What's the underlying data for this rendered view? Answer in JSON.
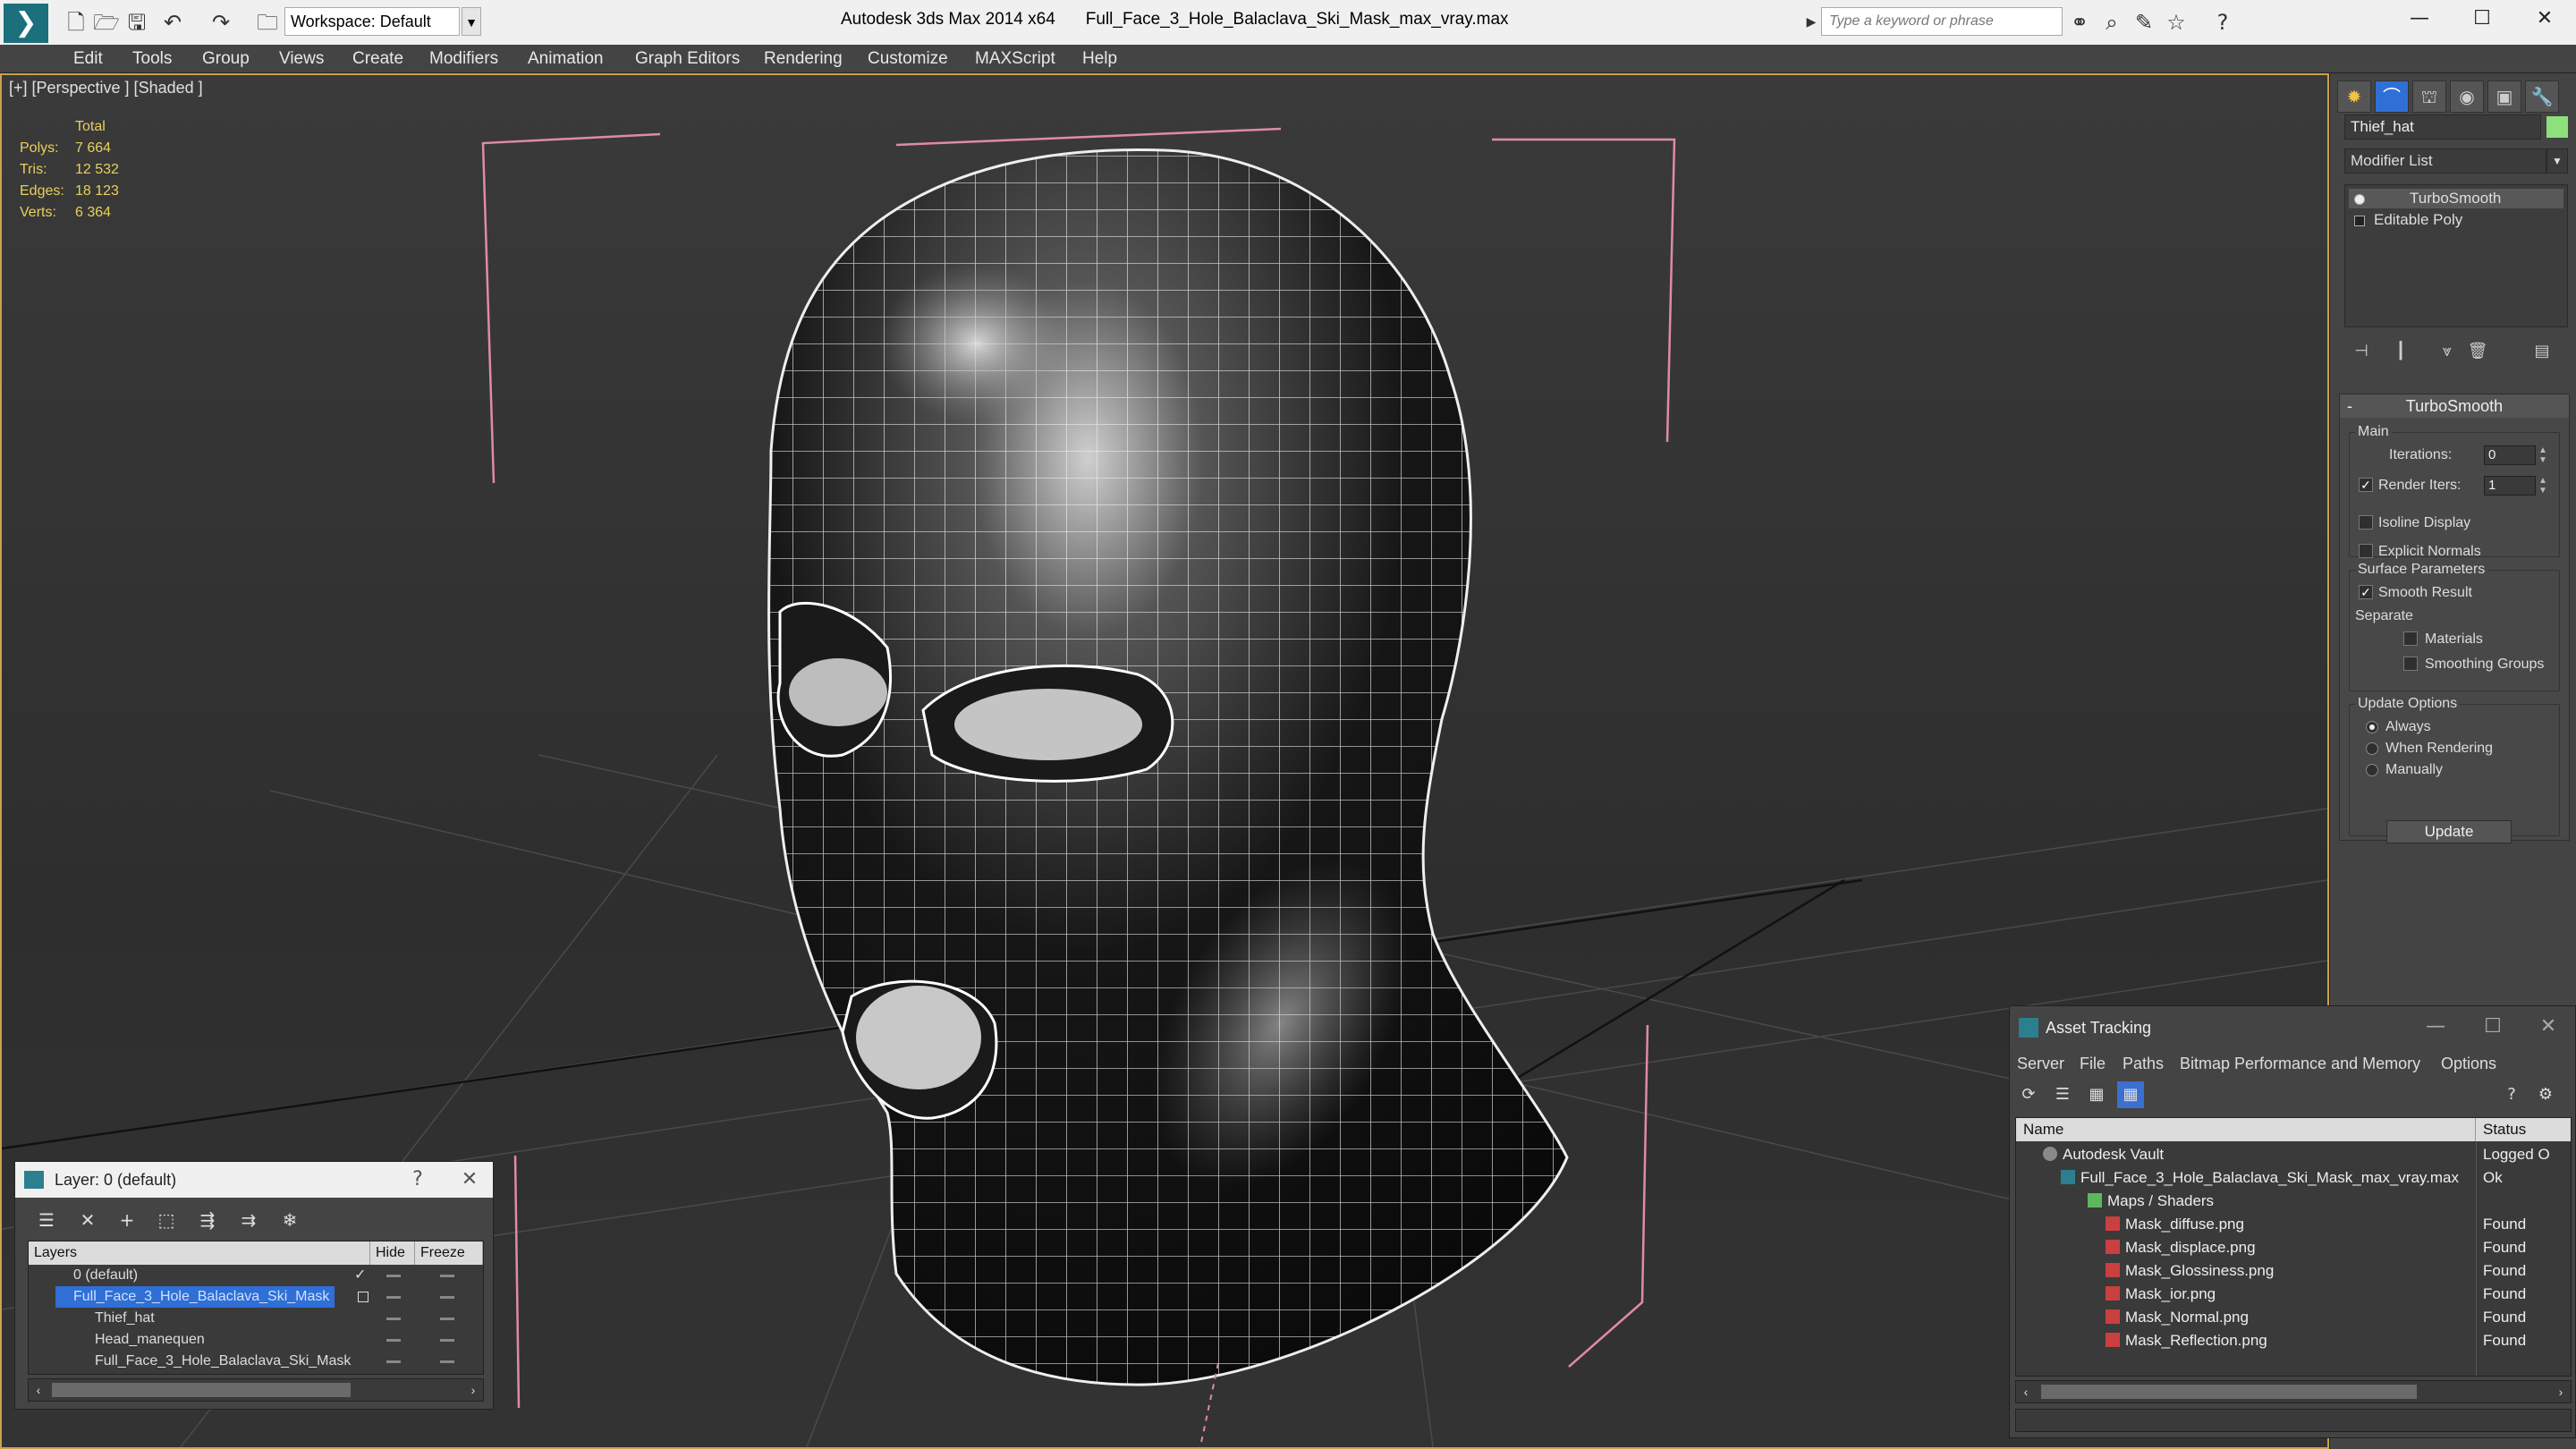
{
  "titlebar": {
    "workspace": "Workspace: Default",
    "app_name": "Autodesk 3ds Max  2014 x64",
    "file_name": "Full_Face_3_Hole_Balaclava_Ski_Mask_max_vray.max",
    "search_placeholder": "Type a keyword or phrase"
  },
  "menu": [
    "Edit",
    "Tools",
    "Group",
    "Views",
    "Create",
    "Modifiers",
    "Animation",
    "Graph Editors",
    "Rendering",
    "Customize",
    "MAXScript",
    "Help"
  ],
  "viewport": {
    "label": "[+] [Perspective ] [Shaded ]",
    "stats_header": "Total",
    "stats": [
      {
        "label": "Polys:",
        "value": "7 664"
      },
      {
        "label": "Tris:",
        "value": "12 532"
      },
      {
        "label": "Edges:",
        "value": "18 123"
      },
      {
        "label": "Verts:",
        "value": "6 364"
      }
    ]
  },
  "command_panel": {
    "object_name": "Thief_hat",
    "object_color": "#8ee07a",
    "modifier_list": "Modifier List",
    "stack": [
      "TurboSmooth",
      "Editable Poly"
    ],
    "rollout_title": "TurboSmooth",
    "main_group": "Main",
    "iterations_label": "Iterations:",
    "iterations_value": "0",
    "render_iters_label": "Render Iters:",
    "render_iters_value": "1",
    "isoline": "Isoline Display",
    "explicit_normals": "Explicit Normals",
    "surface_group": "Surface Parameters",
    "smooth_result": "Smooth Result",
    "separate": "Separate",
    "materials": "Materials",
    "smoothing_groups": "Smoothing Groups",
    "update_group": "Update Options",
    "always": "Always",
    "when_rendering": "When Rendering",
    "manually": "Manually",
    "update_button": "Update"
  },
  "layer_dialog": {
    "title": "Layer: 0 (default)",
    "help": "?",
    "col_layers": "Layers",
    "col_hide": "Hide",
    "col_freeze": "Freeze",
    "rows": [
      {
        "name": "0 (default)",
        "indent": 0
      },
      {
        "name": "Full_Face_3_Hole_Balaclava_Ski_Mask",
        "indent": 0
      },
      {
        "name": "Thief_hat",
        "indent": 1
      },
      {
        "name": "Head_manequen",
        "indent": 1
      },
      {
        "name": "Full_Face_3_Hole_Balaclava_Ski_Mask",
        "indent": 1
      }
    ]
  },
  "asset_tracking": {
    "title": "Asset Tracking",
    "menu": [
      "Server",
      "File",
      "Paths",
      "Bitmap Performance and Memory",
      "Options"
    ],
    "col_name": "Name",
    "col_status": "Status",
    "rows": [
      {
        "name": "Autodesk Vault",
        "status": "Logged O"
      },
      {
        "name": "Full_Face_3_Hole_Balaclava_Ski_Mask_max_vray.max",
        "status": "Ok"
      },
      {
        "name": "Maps / Shaders",
        "status": ""
      },
      {
        "name": "Mask_diffuse.png",
        "status": "Found"
      },
      {
        "name": "Mask_displace.png",
        "status": "Found"
      },
      {
        "name": "Mask_Glossiness.png",
        "status": "Found"
      },
      {
        "name": "Mask_ior.png",
        "status": "Found"
      },
      {
        "name": "Mask_Normal.png",
        "status": "Found"
      },
      {
        "name": "Mask_Reflection.png",
        "status": "Found"
      }
    ]
  }
}
